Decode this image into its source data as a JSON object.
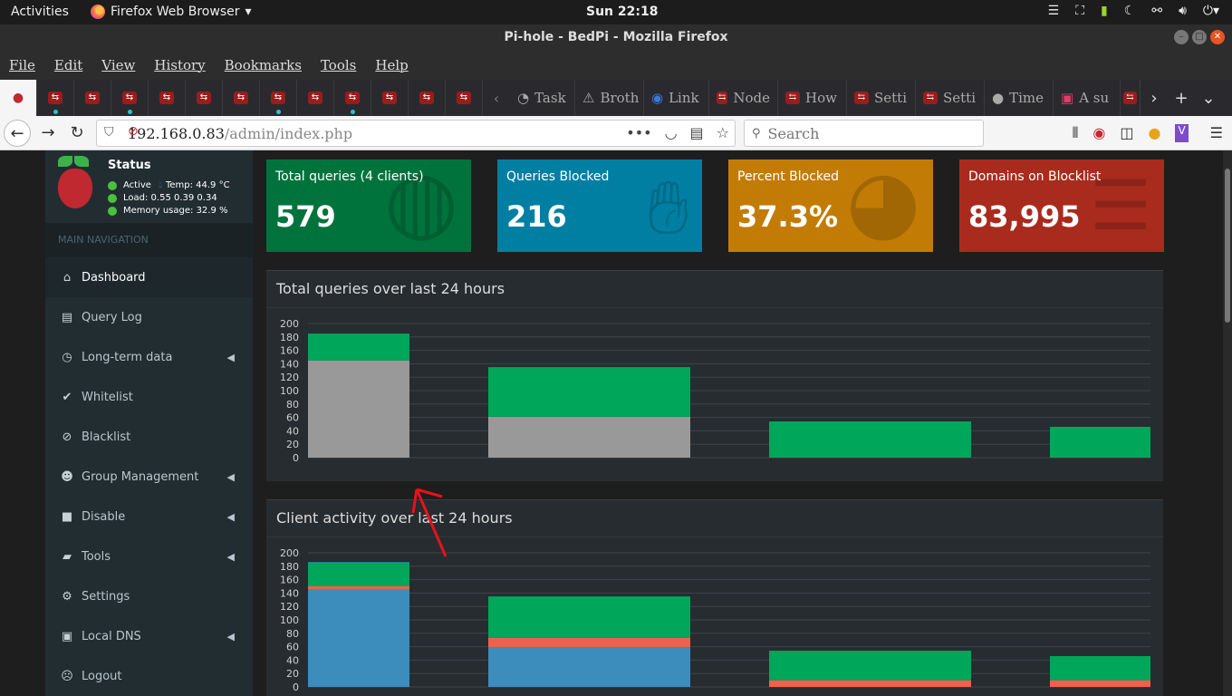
{
  "system": {
    "activities": "Activities",
    "app_name": "Firefox Web Browser",
    "clock": "Sun 22:18"
  },
  "window": {
    "title": "Pi-hole - BedPi - Mozilla Firefox"
  },
  "menubar": [
    "File",
    "Edit",
    "View",
    "History",
    "Bookmarks",
    "Tools",
    "Help"
  ],
  "tabs": {
    "text_tabs": [
      "Task",
      "Broth",
      "Link",
      "Node",
      "How",
      "Setti",
      "Setti",
      "Time",
      "A su"
    ]
  },
  "navbar": {
    "url_host": "192.168.0.83",
    "url_path": "/admin/index.php",
    "search_placeholder": "Search"
  },
  "sidebar": {
    "status_title": "Status",
    "active": "Active",
    "temp": "Temp: 44.9 °C",
    "load": "Load:  0.55  0.39  0.34",
    "memory": "Memory usage:  32.9 %",
    "nav_header": "MAIN NAVIGATION",
    "items": [
      {
        "label": "Dashboard",
        "icon": "home-icon"
      },
      {
        "label": "Query Log",
        "icon": "file-icon"
      },
      {
        "label": "Long-term data",
        "icon": "clock-icon"
      },
      {
        "label": "Whitelist",
        "icon": "check-circle-icon"
      },
      {
        "label": "Blacklist",
        "icon": "ban-icon"
      },
      {
        "label": "Group Management",
        "icon": "users-icon"
      },
      {
        "label": "Disable",
        "icon": "square-icon"
      },
      {
        "label": "Tools",
        "icon": "folder-icon"
      },
      {
        "label": "Settings",
        "icon": "cogs-icon"
      },
      {
        "label": "Local DNS",
        "icon": "address-book-icon"
      },
      {
        "label": "Logout",
        "icon": "user-times-icon"
      }
    ]
  },
  "stats": [
    {
      "label": "Total queries (4 clients)",
      "value": "579",
      "color": "#00733d",
      "icon": "globe-icon"
    },
    {
      "label": "Queries Blocked",
      "value": "216",
      "color": "#007fa3",
      "icon": "hand-icon"
    },
    {
      "label": "Percent Blocked",
      "value": "37.3%",
      "color": "#c27c06",
      "icon": "pie-chart-icon"
    },
    {
      "label": "Domains on Blocklist",
      "value": "83,995",
      "color": "#a92b1e",
      "icon": "list-icon"
    }
  ],
  "charts": {
    "queries_title": "Total queries over last 24 hours",
    "clients_title": "Client activity over last 24 hours"
  },
  "chart_data": [
    {
      "type": "bar",
      "title": "Total queries over last 24 hours",
      "ylim": [
        0,
        200
      ],
      "yticks": [
        0,
        20,
        40,
        60,
        80,
        100,
        120,
        140,
        160,
        180,
        200
      ],
      "series": [
        {
          "color": "#999999",
          "values": [
            145,
            61,
            0,
            0
          ]
        },
        {
          "color": "#00a65a",
          "values": [
            40,
            74,
            54,
            46
          ]
        }
      ]
    },
    {
      "type": "bar",
      "title": "Client activity over last 24 hours",
      "ylim": [
        0,
        200
      ],
      "yticks": [
        0,
        20,
        40,
        60,
        80,
        100,
        120,
        140,
        160,
        180,
        200
      ],
      "series": [
        {
          "color": "#3c8dbc",
          "values": [
            145,
            59,
            0,
            0
          ]
        },
        {
          "color": "#f0604a",
          "values": [
            5,
            14,
            10,
            10
          ]
        },
        {
          "color": "#00a65a",
          "values": [
            35,
            62,
            44,
            36
          ]
        },
        {
          "color": "#1a9fd0",
          "values": [
            1,
            0,
            0,
            0
          ]
        }
      ]
    }
  ]
}
